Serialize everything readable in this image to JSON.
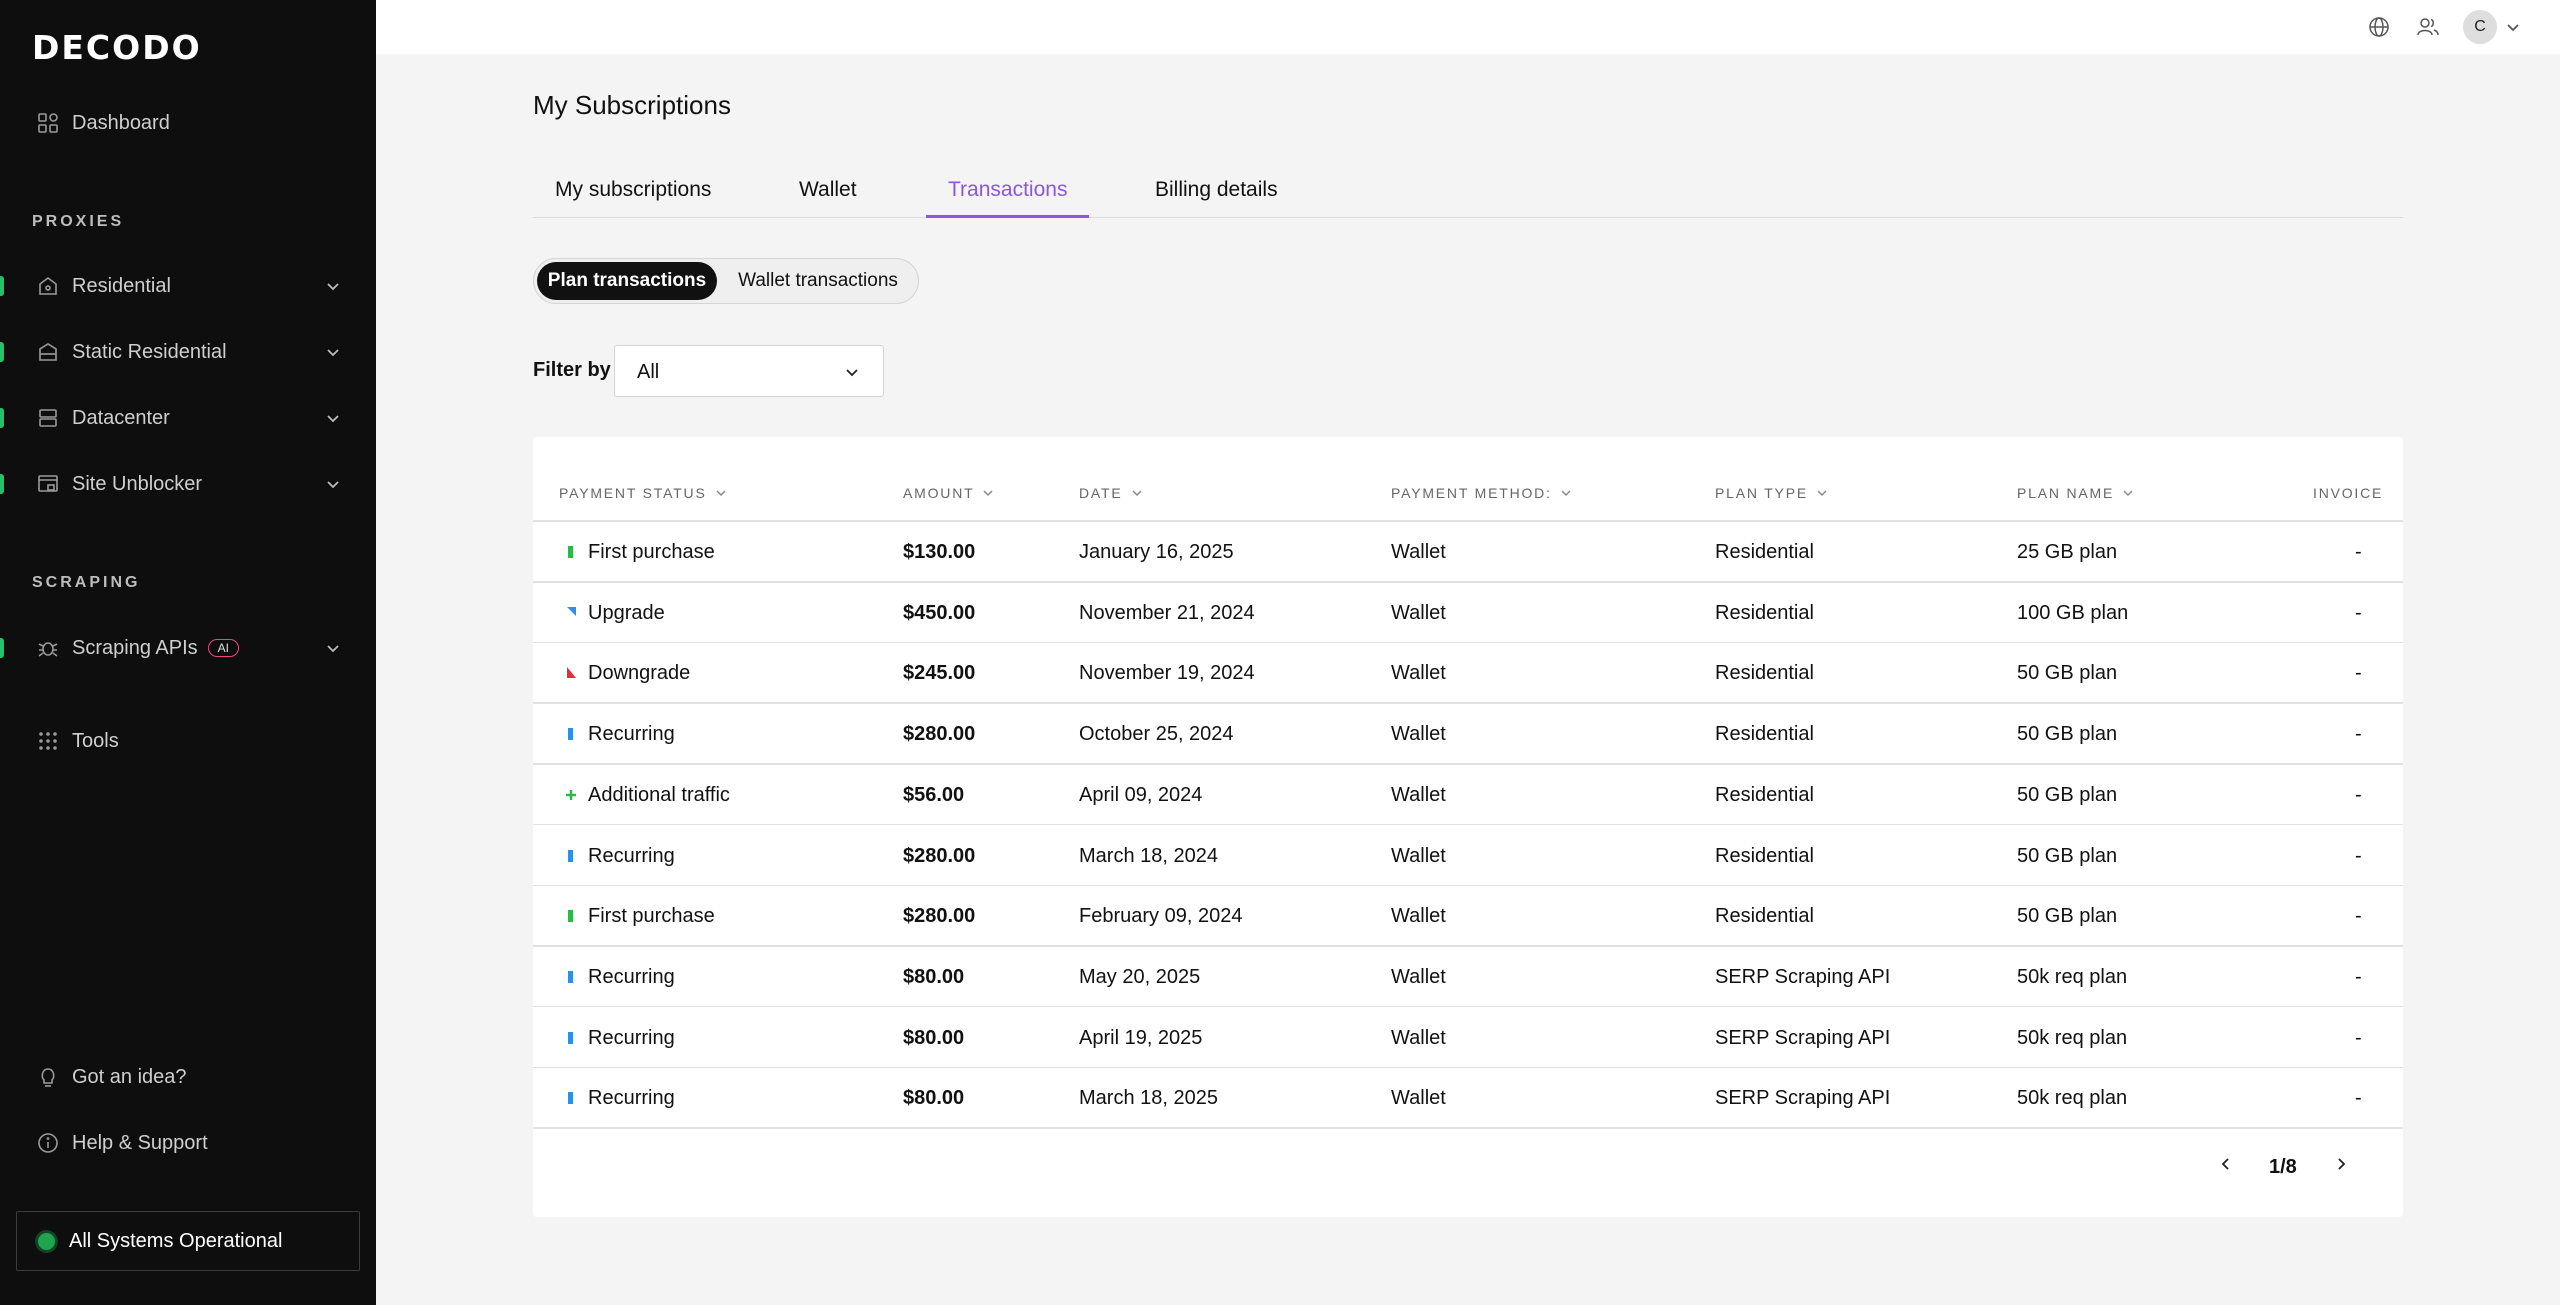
{
  "sidebar": {
    "logo": "DECODO",
    "dashboard": "Dashboard",
    "proxies_title": "PROXIES",
    "residential": "Residential",
    "static_residential": "Static Residential",
    "datacenter": "Datacenter",
    "site_unblocker": "Site Unblocker",
    "scraping_title": "SCRAPING",
    "scraping_apis": "Scraping APIs",
    "ai_badge": "AI",
    "tools": "Tools",
    "got_idea": "Got an idea?",
    "help_support": "Help & Support",
    "status": "All Systems Operational",
    "accent_color": "#21c36b"
  },
  "topbar": {
    "avatar_initial": "C"
  },
  "main": {
    "title": "My Subscriptions",
    "tabs": [
      {
        "label": "My subscriptions"
      },
      {
        "label": "Wallet"
      },
      {
        "label": "Transactions"
      },
      {
        "label": "Billing details"
      }
    ],
    "active_tab": "Transactions",
    "segments": {
      "plan": "Plan transactions",
      "wallet": "Wallet transactions"
    },
    "filter": {
      "label": "Filter by",
      "value": "All"
    },
    "accent_color": "#8a57e0"
  },
  "table": {
    "headers": {
      "status": "PAYMENT STATUS",
      "amount": "AMOUNT",
      "date": "DATE",
      "method": "PAYMENT METHOD:",
      "plan_type": "PLAN TYPE",
      "plan_name": "PLAN NAME",
      "invoice": "INVOICE"
    },
    "rows": [
      {
        "status": "First purchase",
        "status_icon": "green-bar-icon",
        "amount": "$130.00",
        "date": "January 16, 2025",
        "method": "Wallet",
        "plan_type": "Residential",
        "plan_name": "25 GB plan",
        "invoice": "-"
      },
      {
        "status": "Upgrade",
        "status_icon": "blue-corner-icon",
        "amount": "$450.00",
        "date": "November 21, 2024",
        "method": "Wallet",
        "plan_type": "Residential",
        "plan_name": "100 GB plan",
        "invoice": "-"
      },
      {
        "status": "Downgrade",
        "status_icon": "red-corner-icon",
        "amount": "$245.00",
        "date": "November 19, 2024",
        "method": "Wallet",
        "plan_type": "Residential",
        "plan_name": "50 GB plan",
        "invoice": "-"
      },
      {
        "status": "Recurring",
        "status_icon": "blue-bar-icon",
        "amount": "$280.00",
        "date": "October 25, 2024",
        "method": "Wallet",
        "plan_type": "Residential",
        "plan_name": "50 GB plan",
        "invoice": "-"
      },
      {
        "status": "Additional traffic",
        "status_icon": "green-plus-icon",
        "amount": "$56.00",
        "date": "April 09, 2024",
        "method": "Wallet",
        "plan_type": "Residential",
        "plan_name": "50 GB plan",
        "invoice": "-"
      },
      {
        "status": "Recurring",
        "status_icon": "blue-bar-icon",
        "amount": "$280.00",
        "date": "March 18, 2024",
        "method": "Wallet",
        "plan_type": "Residential",
        "plan_name": "50 GB plan",
        "invoice": "-"
      },
      {
        "status": "First purchase",
        "status_icon": "green-bar-icon",
        "amount": "$280.00",
        "date": "February 09, 2024",
        "method": "Wallet",
        "plan_type": "Residential",
        "plan_name": "50 GB plan",
        "invoice": "-"
      },
      {
        "status": "Recurring",
        "status_icon": "blue-bar-icon",
        "amount": "$80.00",
        "date": "May 20, 2025",
        "method": "Wallet",
        "plan_type": "SERP Scraping API",
        "plan_name": "50k req plan",
        "invoice": "-"
      },
      {
        "status": "Recurring",
        "status_icon": "blue-bar-icon",
        "amount": "$80.00",
        "date": "April 19, 2025",
        "method": "Wallet",
        "plan_type": "SERP Scraping API",
        "plan_name": "50k req plan",
        "invoice": "-"
      },
      {
        "status": "Recurring",
        "status_icon": "blue-bar-icon",
        "amount": "$80.00",
        "date": "March 18, 2025",
        "method": "Wallet",
        "plan_type": "SERP Scraping API",
        "plan_name": "50k req plan",
        "invoice": "-"
      }
    ],
    "pagination": "1/8"
  }
}
